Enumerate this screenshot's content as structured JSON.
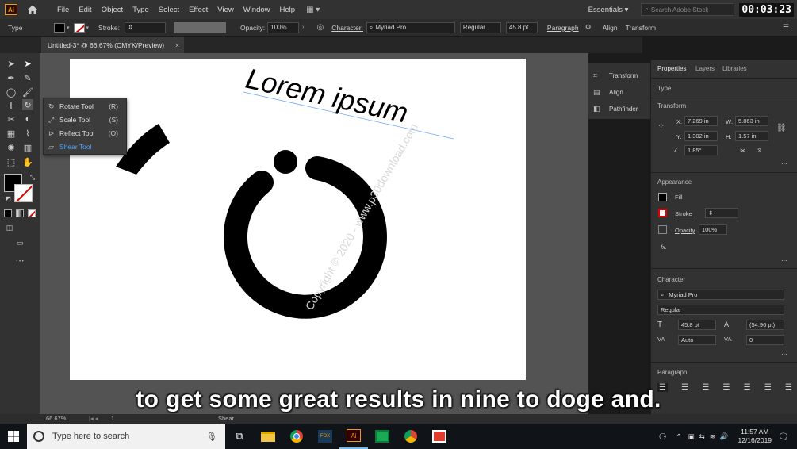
{
  "menubar": {
    "app_logo": "Ai",
    "items": [
      "File",
      "Edit",
      "Object",
      "Type",
      "Select",
      "Effect",
      "View",
      "Window",
      "Help"
    ],
    "workspace": "Essentials",
    "search_placeholder": "Search Adobe Stock",
    "timer": "00:03:23"
  },
  "control_bar": {
    "selection_type": "Type",
    "stroke_label": "Stroke:",
    "opacity_label": "Opacity:",
    "opacity_value": "100%",
    "character_label": "Character:",
    "font_family": "Myriad Pro",
    "font_style": "Regular",
    "font_size": "45.8 pt",
    "paragraph_label": "Paragraph",
    "align_label": "Align",
    "transform_label": "Transform"
  },
  "document_tab": {
    "title": "Untitled-3* @ 66.67% (CMYK/Preview)",
    "close": "×"
  },
  "tool_flyout": {
    "items": [
      {
        "label": "Rotate Tool",
        "shortcut": "(R)"
      },
      {
        "label": "Scale Tool",
        "shortcut": "(S)"
      },
      {
        "label": "Reflect Tool",
        "shortcut": "(O)"
      },
      {
        "label": "Shear Tool",
        "shortcut": ""
      }
    ]
  },
  "artboard": {
    "text": "Lorem ipsum",
    "watermark": "Copyright © 2020 - www.p30download.com"
  },
  "dock": {
    "items": [
      "Transform",
      "Align",
      "Pathfinder"
    ]
  },
  "properties": {
    "tabs": [
      "Properties",
      "Layers",
      "Libraries"
    ],
    "type_section": "Type",
    "transform_section": "Transform",
    "x_label": "X:",
    "x": "7.269 in",
    "y_label": "Y:",
    "y": "1.302 in",
    "w_label": "W:",
    "w": "5.863 in",
    "h_label": "H:",
    "h": "1.57 in",
    "angle": "1.85°",
    "appearance_section": "Appearance",
    "fill_label": "Fill",
    "stroke_label": "Stroke",
    "opacity_label": "Opacity",
    "opacity_value": "100%",
    "fx": "fx.",
    "character_section": "Character",
    "font_family": "Myriad Pro",
    "font_style": "Regular",
    "font_size": "45.8 pt",
    "leading": "(54.96 pt)",
    "kerning": "Auto",
    "tracking": "0",
    "paragraph_section": "Paragraph"
  },
  "statusbar": {
    "zoom": "66.67%",
    "artboard_number": "1",
    "tool_name": "Shear"
  },
  "subtitle": "to get some great results in nine to doge and.",
  "taskbar": {
    "search_placeholder": "Type here to search",
    "time": "11:57 AM",
    "date": "12/16/2019"
  },
  "colors": {
    "accent": "#4aa6ff",
    "ui_dark": "#323232",
    "canvas": "#535353",
    "artwork": "#000000"
  }
}
